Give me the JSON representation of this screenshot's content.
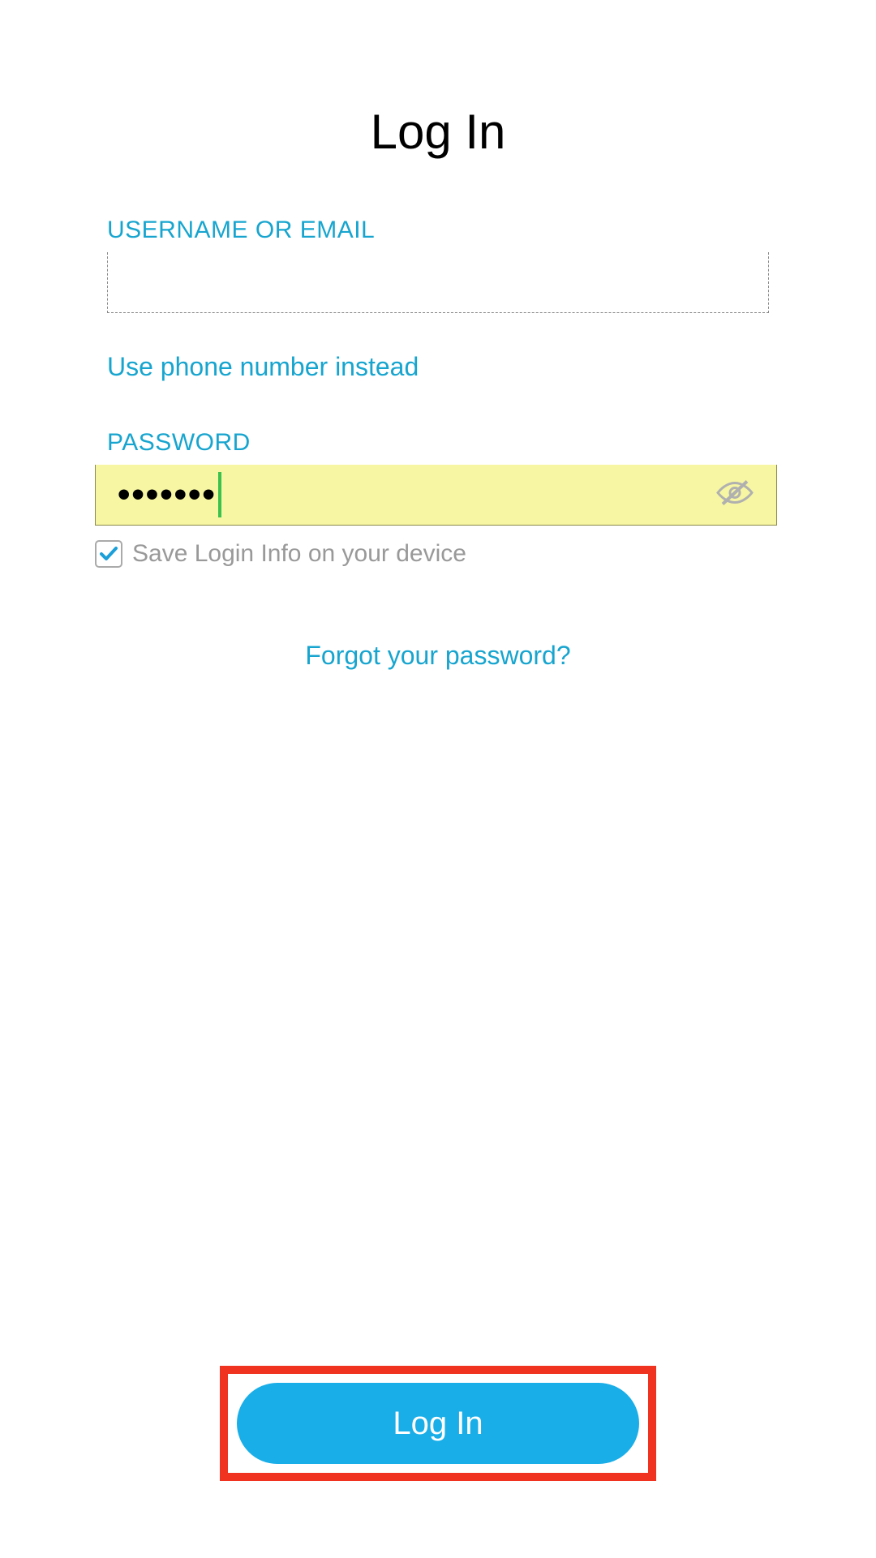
{
  "title": "Log In",
  "username": {
    "label": "USERNAME OR EMAIL",
    "value": ""
  },
  "use_phone_link": "Use phone number instead",
  "password": {
    "label": "PASSWORD",
    "masked_value": "•••••••"
  },
  "save_login": {
    "checked": true,
    "label": "Save Login Info on your device"
  },
  "forgot_link": "Forgot your password?",
  "login_button": "Log In",
  "colors": {
    "accent": "#17a5cf",
    "button_bg": "#19aee8",
    "highlight_border": "#ef3320",
    "autofill_bg": "#f7f6a3"
  }
}
